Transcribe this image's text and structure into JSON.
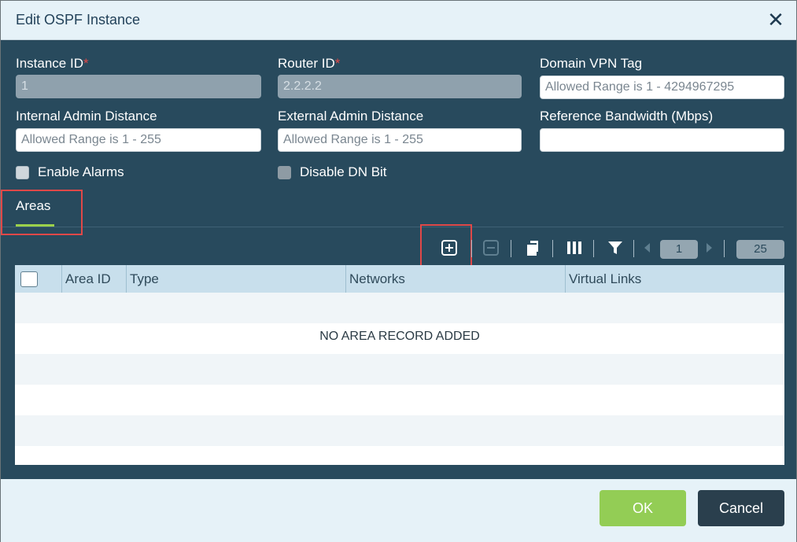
{
  "dialog": {
    "title": "Edit OSPF Instance",
    "close_symbol": "✕"
  },
  "fields": {
    "instance_id": {
      "label": "Instance ID",
      "required_mark": "*",
      "value": "1"
    },
    "router_id": {
      "label": "Router ID",
      "required_mark": "*",
      "value": "2.2.2.2"
    },
    "domain_vpn_tag": {
      "label": "Domain VPN Tag",
      "placeholder": "Allowed Range is 1 - 4294967295"
    },
    "internal_admin_distance": {
      "label": "Internal Admin Distance",
      "placeholder": "Allowed Range is 1 - 255"
    },
    "external_admin_distance": {
      "label": "External Admin Distance",
      "placeholder": "Allowed Range is 1 - 255"
    },
    "reference_bandwidth": {
      "label": "Reference Bandwidth (Mbps)",
      "placeholder": ""
    }
  },
  "checkboxes": {
    "enable_alarms": {
      "label": "Enable Alarms",
      "checked": false
    },
    "disable_dn_bit": {
      "label": "Disable DN Bit",
      "checked": false
    }
  },
  "tabs": {
    "areas": "Areas"
  },
  "toolbar": {
    "page_number": "1",
    "page_size": "25",
    "icons": [
      "add-icon",
      "remove-icon",
      "copy-icon",
      "columns-icon",
      "filter-icon",
      "prev-page-icon",
      "next-page-icon"
    ]
  },
  "grid": {
    "columns": [
      "Area ID",
      "Type",
      "Networks",
      "Virtual Links"
    ],
    "empty_message": "NO AREA RECORD ADDED"
  },
  "footer": {
    "ok_label": "OK",
    "cancel_label": "Cancel"
  },
  "colors": {
    "body_bg": "#284a5d",
    "accent_green": "#93cd55",
    "highlight_red": "#e04848"
  }
}
